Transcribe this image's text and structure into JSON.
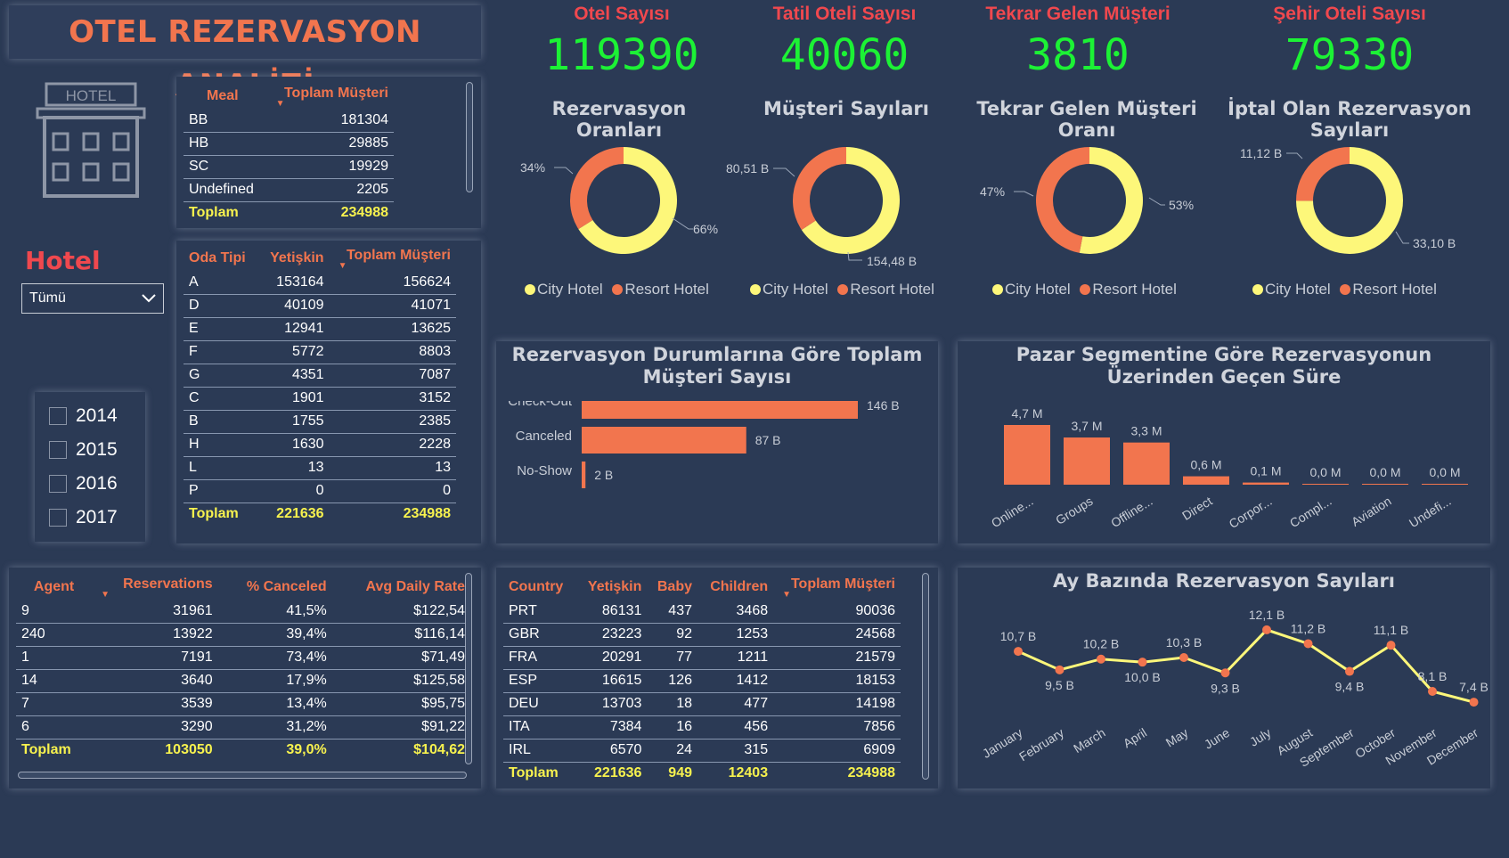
{
  "title": "OTEL REZERVASYON ANALİZİ",
  "kpis": [
    {
      "label": "Otel Sayısı",
      "value": "119390"
    },
    {
      "label": "Tatil Oteli Sayısı",
      "value": "40060"
    },
    {
      "label": "Tekrar Gelen Müşteri",
      "value": "3810"
    },
    {
      "label": "Şehir Oteli Sayısı",
      "value": "79330"
    }
  ],
  "hotel_icon_text": "HOTEL",
  "filter": {
    "label": "Hotel",
    "selected": "Tümü",
    "years": [
      "2014",
      "2015",
      "2016",
      "2017"
    ]
  },
  "colors": {
    "city": "#fdf77a",
    "resort": "#f2754e",
    "kpi": "#1cf235",
    "header": "#f2754e",
    "total": "#f7f24e"
  },
  "legend": {
    "city": "City Hotel",
    "resort": "Resort Hotel"
  },
  "meal_table": {
    "headers": [
      "Meal",
      "Toplam Müşteri"
    ],
    "rows": [
      [
        "BB",
        "181304"
      ],
      [
        "HB",
        "29885"
      ],
      [
        "SC",
        "19929"
      ],
      [
        "Undefined",
        "2205"
      ]
    ],
    "total": [
      "Toplam",
      "234988"
    ]
  },
  "room_table": {
    "headers": [
      "Oda Tipi",
      "Yetişkin",
      "Toplam Müşteri"
    ],
    "rows": [
      [
        "A",
        "153164",
        "156624"
      ],
      [
        "D",
        "40109",
        "41071"
      ],
      [
        "E",
        "12941",
        "13625"
      ],
      [
        "F",
        "5772",
        "8803"
      ],
      [
        "G",
        "4351",
        "7087"
      ],
      [
        "C",
        "1901",
        "3152"
      ],
      [
        "B",
        "1755",
        "2385"
      ],
      [
        "H",
        "1630",
        "2228"
      ],
      [
        "L",
        "13",
        "13"
      ],
      [
        "P",
        "0",
        "0"
      ]
    ],
    "total": [
      "Toplam",
      "221636",
      "234988"
    ]
  },
  "agent_table": {
    "headers": [
      "Agent",
      "Reservations",
      "% Canceled",
      "Avg Daily Rate"
    ],
    "rows": [
      [
        "9",
        "31961",
        "41,5%",
        "$122,54"
      ],
      [
        "240",
        "13922",
        "39,4%",
        "$116,14"
      ],
      [
        "1",
        "7191",
        "73,4%",
        "$71,49"
      ],
      [
        "14",
        "3640",
        "17,9%",
        "$125,58"
      ],
      [
        "7",
        "3539",
        "13,4%",
        "$95,75"
      ],
      [
        "6",
        "3290",
        "31,2%",
        "$91,22"
      ]
    ],
    "total": [
      "Toplam",
      "103050",
      "39,0%",
      "$104,62"
    ]
  },
  "country_table": {
    "headers": [
      "Country",
      "Yetişkin",
      "Baby",
      "Children",
      "Toplam Müşteri"
    ],
    "rows": [
      [
        "PRT",
        "86131",
        "437",
        "3468",
        "90036"
      ],
      [
        "GBR",
        "23223",
        "92",
        "1253",
        "24568"
      ],
      [
        "FRA",
        "20291",
        "77",
        "1211",
        "21579"
      ],
      [
        "ESP",
        "16615",
        "126",
        "1412",
        "18153"
      ],
      [
        "DEU",
        "13703",
        "18",
        "477",
        "14198"
      ],
      [
        "ITA",
        "7384",
        "16",
        "456",
        "7856"
      ],
      [
        "IRL",
        "6570",
        "24",
        "315",
        "6909"
      ]
    ],
    "total": [
      "Toplam",
      "221636",
      "949",
      "12403",
      "234988"
    ]
  },
  "chart_data": [
    {
      "type": "pie",
      "title": "Rezervasyon Oranları",
      "categories": [
        "City Hotel",
        "Resort Hotel"
      ],
      "values": [
        66,
        34
      ],
      "labels": [
        "66%",
        "34%"
      ]
    },
    {
      "type": "pie",
      "title": "Müşteri Sayıları",
      "categories": [
        "City Hotel",
        "Resort Hotel"
      ],
      "values": [
        154.48,
        80.51
      ],
      "labels": [
        "154,48 B",
        "80,51 B"
      ]
    },
    {
      "type": "pie",
      "title": "Tekrar Gelen Müşteri Oranı",
      "categories": [
        "City Hotel",
        "Resort Hotel"
      ],
      "values": [
        53,
        47
      ],
      "labels": [
        "53%",
        "47%"
      ]
    },
    {
      "type": "pie",
      "title": "İptal Olan Rezervasyon Sayıları",
      "categories": [
        "City Hotel",
        "Resort Hotel"
      ],
      "values": [
        33.1,
        11.12
      ],
      "labels": [
        "33,10 B",
        "11,12 B"
      ]
    },
    {
      "type": "bar",
      "orientation": "horizontal",
      "title": "Rezervasyon Durumlarına Göre Toplam Müşteri Sayısı",
      "categories": [
        "Check-Out",
        "Canceled",
        "No-Show"
      ],
      "values": [
        146,
        87,
        2
      ],
      "labels": [
        "146 B",
        "87 B",
        "2 B"
      ]
    },
    {
      "type": "bar",
      "title": "Pazar Segmentine Göre Rezervasyonun Üzerinden Geçen Süre",
      "categories": [
        "Online...",
        "Groups",
        "Offline...",
        "Direct",
        "Corpor...",
        "Compl...",
        "Aviation",
        "Undefi..."
      ],
      "values": [
        4.7,
        3.7,
        3.3,
        0.6,
        0.1,
        0.0,
        0.0,
        0.0
      ],
      "labels": [
        "4,7 M",
        "3,7 M",
        "3,3 M",
        "0,6 M",
        "0,1 M",
        "0,0 M",
        "0,0 M",
        "0,0 M"
      ]
    },
    {
      "type": "line",
      "title": "Ay Bazında Rezervasyon Sayıları",
      "categories": [
        "January",
        "February",
        "March",
        "April",
        "May",
        "June",
        "July",
        "August",
        "September",
        "October",
        "November",
        "December"
      ],
      "values": [
        10.7,
        9.5,
        10.2,
        10.0,
        10.3,
        9.3,
        12.1,
        11.2,
        9.4,
        11.1,
        8.1,
        7.4
      ],
      "labels": [
        "10,7 B",
        "9,5 B",
        "10,2 B",
        "10,0 B",
        "10,3 B",
        "9,3 B",
        "12,1 B",
        "11,2 B",
        "9,4 B",
        "11,1 B",
        "8,1 B",
        "7,4 B"
      ]
    }
  ]
}
